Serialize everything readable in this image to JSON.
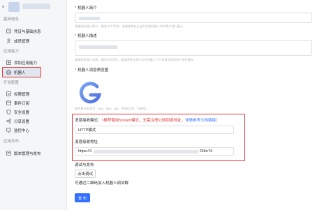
{
  "sidebar": {
    "back_icon": "chevron-left-icon",
    "groups": [
      {
        "label": "基础信息"
      },
      {
        "label": "应用能力"
      },
      {
        "label": "开发配置"
      },
      {
        "label": "应用发布"
      }
    ],
    "items": [
      {
        "label": "凭证与基础信息",
        "icon": "credential-icon"
      },
      {
        "label": "成员管理",
        "icon": "member-icon"
      },
      {
        "label": "添加应用能力",
        "icon": "add-capability-icon"
      },
      {
        "label": "机器人",
        "icon": "robot-icon"
      },
      {
        "label": "权限管理",
        "icon": "permission-icon"
      },
      {
        "label": "事件订阅",
        "icon": "event-icon"
      },
      {
        "label": "安全设置",
        "icon": "security-icon"
      },
      {
        "label": "分享设置",
        "icon": "share-icon"
      },
      {
        "label": "监控中心",
        "icon": "monitor-icon"
      },
      {
        "label": "版本管理与发布",
        "icon": "version-icon"
      }
    ],
    "highlight_color": "#e0383e"
  },
  "main": {
    "intro": {
      "label": "机器人简介",
      "hint": "请描述机器人简介，最多10个字符，该描述将在企业内添加机器人时向用户进行展示"
    },
    "desc": {
      "label": "机器人描述",
      "hint": "请描述机器人功能，最多200字符，该描述将在用户点开机器人个人信息页时向用户进行展示"
    },
    "preview": {
      "label": "机器人消息预览图",
      "hint": "图片格式必须为：png、jpeg、jpg，不超过2M，可调用。"
    },
    "msg_mode": {
      "label": "消息接收模式：",
      "note": "（推荐使用Stream模式，无需注册公网回调地址，",
      "link": "详情参考文档链接",
      "close": "）",
      "value": "HTTP模式"
    },
    "msg_url": {
      "label": "消息接收地址",
      "prefix": "https://1",
      "suffix": "256e74"
    },
    "debug": {
      "label": "调试与发布",
      "button": "点击调试",
      "hint": "可通过二维码加入机器人调试群"
    },
    "publish_button": "发 布",
    "accent_color": "#3370ff"
  }
}
